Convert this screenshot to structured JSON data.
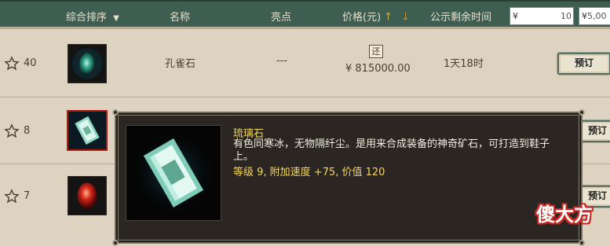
{
  "header": {
    "sort_label": "综合排序",
    "name_label": "名称",
    "highlight_label": "亮点",
    "price_label": "价格(元)",
    "time_label": "公示剩余时间",
    "price_min": {
      "currency": "¥",
      "value": "10"
    },
    "price_max": {
      "currency": "¥",
      "value": "5,00"
    }
  },
  "rows": [
    {
      "fav_count": "40",
      "name": "孔雀石",
      "highlight": "---",
      "return_badge": "还",
      "price": "¥ 815000.00",
      "time_left": "1天18时",
      "reserve_label": "预订"
    },
    {
      "fav_count": "8",
      "reserve_label": "预订"
    },
    {
      "fav_count": "7",
      "reserve_label": "预订"
    }
  ],
  "tooltip": {
    "title": "琉璃石",
    "description": "有色同寒冰，无物隔纤尘。是用来合成装备的神奇矿石，可打造到鞋子上。",
    "stats": "等级 9, 附加速度 +75, 价值 120"
  },
  "watermark": "傻大方",
  "colors": {
    "header_bg": "#3f5e52",
    "page_bg": "#ddd3c0",
    "tooltip_bg": "#2b2621",
    "tooltip_accent": "#f4d75c",
    "selected_border": "#b01a10"
  },
  "icons": [
    "star-outline-icon",
    "sort-desc-triangle-icon",
    "arrow-up-icon",
    "arrow-down-icon",
    "peacock-stone-icon",
    "glass-stone-icon",
    "red-gem-icon"
  ]
}
